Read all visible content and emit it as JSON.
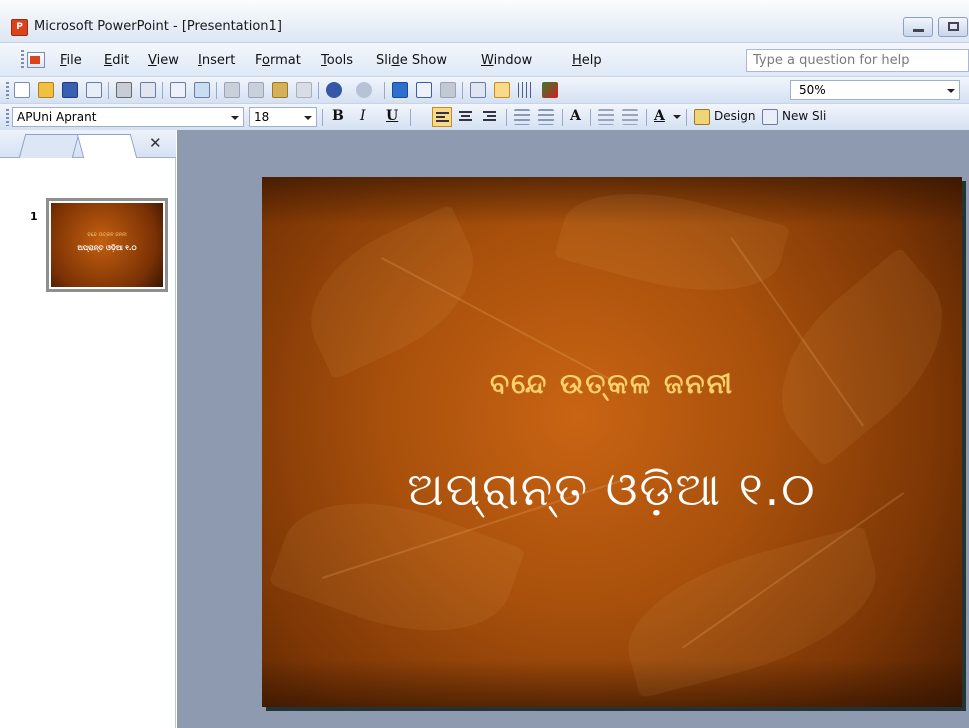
{
  "window": {
    "title": "Microsoft PowerPoint - [Presentation1]",
    "app_icon": "powerpoint-icon",
    "app_glyph": "P"
  },
  "menu": {
    "items": [
      "File",
      "Edit",
      "View",
      "Insert",
      "Format",
      "Tools",
      "Slide Show",
      "Window",
      "Help"
    ],
    "underline": [
      "F",
      "E",
      "V",
      "I",
      "o",
      "T",
      "d",
      "W",
      "H"
    ],
    "help_placeholder": "Type a question for help"
  },
  "standard_toolbar": {
    "zoom": "50%"
  },
  "formatting_toolbar": {
    "font_name": "APUni Aprant",
    "font_size": "18",
    "bold": "B",
    "italic": "I",
    "underline": "U",
    "font_color_glyph": "A",
    "grow_font_glyph": "A",
    "design_label": "Design",
    "new_slide_label": "New Sli"
  },
  "pane": {
    "close_glyph": "✕",
    "slide_number": "1",
    "thumb_subtitle": "ବନ୍ଦେ ଉତ୍କଳ ଜନନୀ",
    "thumb_title": "ଅପ୍ରାନ୍ତ ଓଡ଼ିଆ ୧.୦"
  },
  "slide": {
    "subtitle": "ବନ୍ଦେ ଉତ୍କଳ ଜନନୀ",
    "title": "ଅପ୍ରାନ୍ତ ଓଡ଼ିଆ ୧.୦"
  },
  "colors": {
    "slide_dark": "#4a1d02",
    "slide_mid": "#a8500c",
    "subtitle_color": "#fbd06b",
    "active_button": "#fbd98a"
  }
}
